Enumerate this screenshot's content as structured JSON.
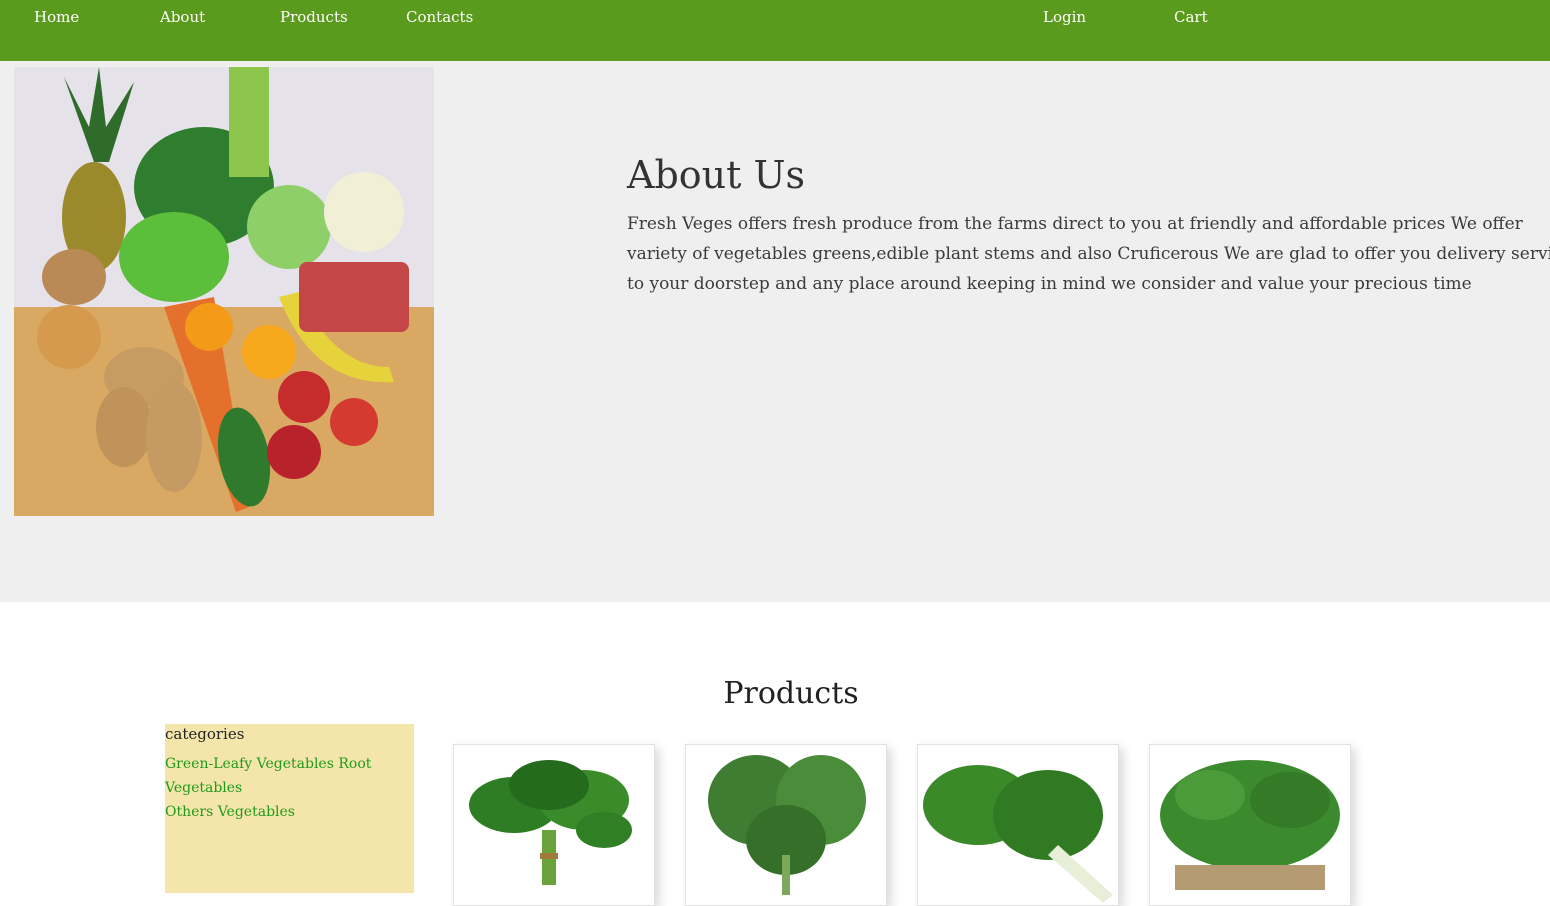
{
  "nav": {
    "home": "Home",
    "about": "About",
    "products": "Products",
    "contacts": "Contacts",
    "login": "Login",
    "cart": "Cart"
  },
  "about": {
    "title": "About Us",
    "text": "Fresh Veges offers fresh produce from the farms direct to you at friendly and affordable prices We offer variety of vegetables greens,edible plant stems and also Cruficerous We are glad to offer you delivery services to your doorstep and any place around keeping in mind we consider and value your precious time",
    "image_icon": "vegetable-basket-photo"
  },
  "products": {
    "title": "Products",
    "categories": {
      "heading": "categories",
      "links": [
        "Green-Leafy Vegetables",
        "Root Vegetables",
        "Others Vegetables"
      ]
    },
    "items": [
      {
        "icon": "spinach-bunch-photo"
      },
      {
        "icon": "collard-greens-photo"
      },
      {
        "icon": "swiss-chard-photo"
      },
      {
        "icon": "microgreens-photo"
      }
    ]
  },
  "colors": {
    "nav_bg": "#5a9a1c",
    "about_bg": "#efefef",
    "categories_bg": "#f4e6ab",
    "link_green": "#1e9a1a"
  }
}
